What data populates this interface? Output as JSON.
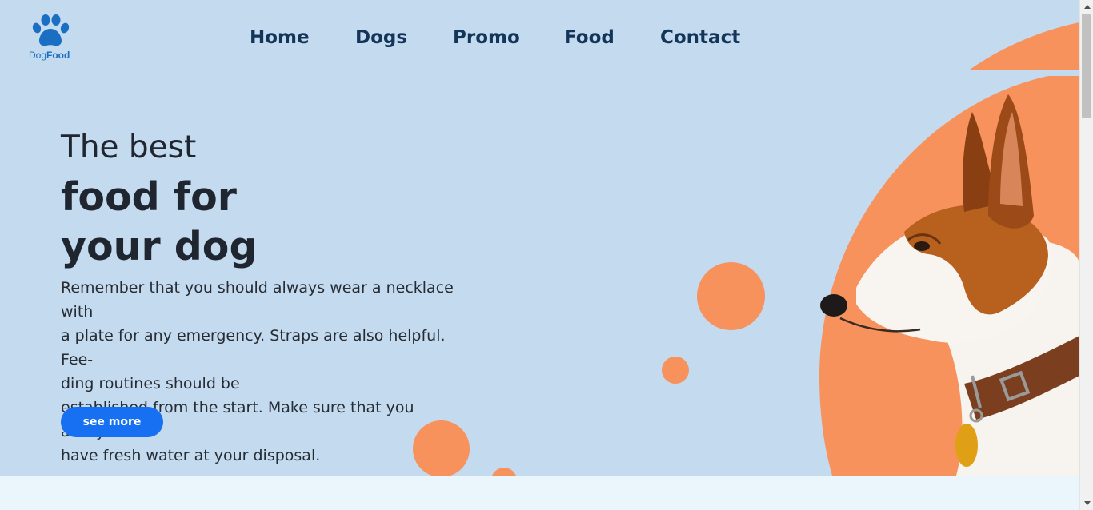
{
  "brand": {
    "logo_prefix": "Dog",
    "logo_suffix": "Food"
  },
  "nav": {
    "items": [
      "Home",
      "Dogs",
      "Promo",
      "Food",
      "Contact"
    ]
  },
  "hero": {
    "headline_line1": "The best",
    "headline_line2": "food for",
    "headline_line3": "your dog",
    "description_lines": [
      "Remember that you should always wear a necklace with",
      "a plate for any emergency. Straps are also helpful. Fee-",
      "ding routines should be",
      "established from the start. Make sure that you always",
      "have fresh water at your disposal."
    ],
    "cta_label": "see more"
  },
  "colors": {
    "background": "#c4daef",
    "accent_orange": "#f7925c",
    "button_blue": "#1670f1",
    "nav_text": "#13355a",
    "logo_blue": "#1b6fc2"
  },
  "icons": {
    "logo": "paw-icon",
    "scroll_up": "triangle-up-icon",
    "scroll_down": "triangle-down-icon"
  }
}
